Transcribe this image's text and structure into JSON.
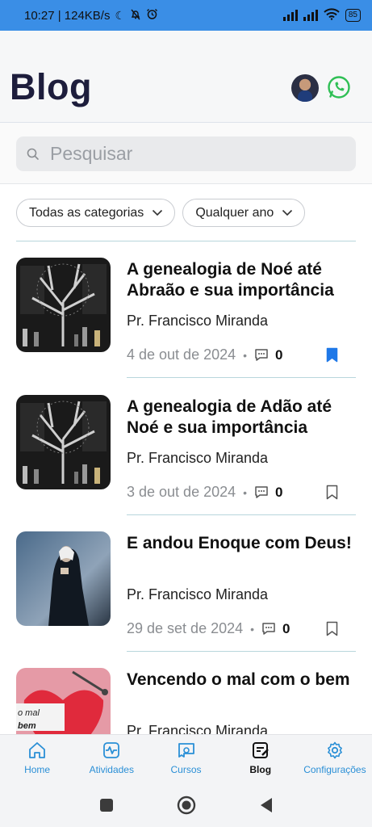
{
  "status_bar": {
    "time_speed": "10:27 | 124KB/s",
    "battery": "85"
  },
  "header": {
    "title": "Blog"
  },
  "search": {
    "placeholder": "Pesquisar"
  },
  "filters": {
    "category": "Todas as categorias",
    "year": "Qualquer ano"
  },
  "posts": [
    {
      "title": "A genealogia de Noé até Abraão e sua importância",
      "author": "Pr. Francisco Miranda",
      "date": "4 de out de 2024",
      "comments": "0",
      "bookmarked": true,
      "thumb": "tree-genealogy-image"
    },
    {
      "title": "A genealogia de Adão até Noé e sua importância",
      "author": "Pr. Francisco Miranda",
      "date": "3 de out de 2024",
      "comments": "0",
      "bookmarked": false,
      "thumb": "tree-genealogy-image"
    },
    {
      "title": "E andou Enoque com Deus!",
      "author": "Pr. Francisco Miranda",
      "date": "29 de set de 2024",
      "comments": "0",
      "bookmarked": false,
      "thumb": "praying-man-image"
    },
    {
      "title": "Vencendo o mal com o bem",
      "author": "Pr. Francisco Miranda",
      "thumb": "heart-mal-image",
      "thumb_text": "o mal bem"
    }
  ],
  "bottom_nav": {
    "items": [
      {
        "label": "Home",
        "icon": "home-icon"
      },
      {
        "label": "Atividades",
        "icon": "activity-icon"
      },
      {
        "label": "Cursos",
        "icon": "courses-icon"
      },
      {
        "label": "Blog",
        "icon": "blog-icon",
        "active": true
      },
      {
        "label": "Configurações",
        "icon": "gear-icon"
      }
    ]
  },
  "colors": {
    "status_bar": "#3a8ee6",
    "accent": "#2a8fd6",
    "bookmark_active": "#1e78e8",
    "title": "#1d1d3c"
  }
}
